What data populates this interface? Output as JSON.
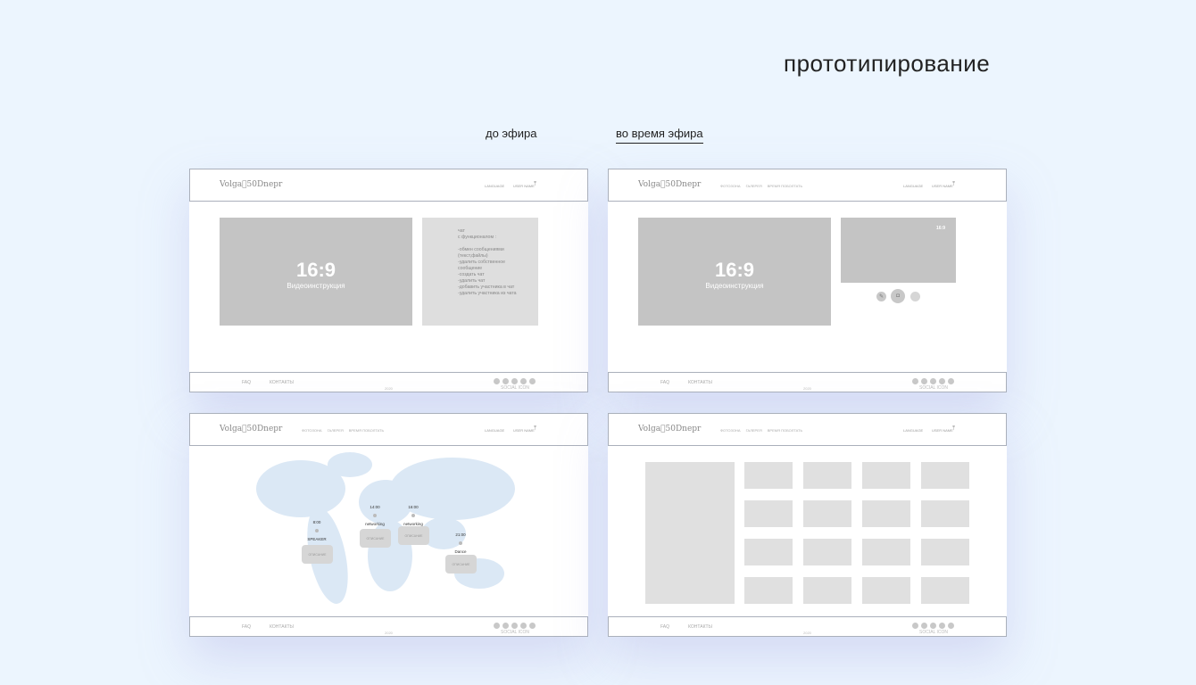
{
  "page_title": "прототипирование",
  "tabs": [
    {
      "label": "до эфира"
    },
    {
      "label": "во время эфира"
    }
  ],
  "header": {
    "logo": "Volga⃝50Dnepr",
    "language": "LANGUAGE",
    "user": "USER NAME",
    "nav": [
      "ФОТОЗОНА",
      "ГАЛЕРЕЯ",
      "ВРЕМЯ ПОБОЛТАТЬ"
    ]
  },
  "footer": {
    "faq": "FAQ",
    "contacts": "КОНТАКТЫ",
    "year": "2020",
    "social": "SOCIAL ICON"
  },
  "video": {
    "ratio": "16:9",
    "caption": "Видеоинструкция"
  },
  "chat": {
    "text": "чат\nс функционалом :\n\n-обмен сообщениями (текст,файлы)\n-удалить собственное сообщение\n-создать чат\n-удалить чат\n-добавить участника в чат\n-удалить участника из чата"
  },
  "small_video": {
    "ratio": "16:9"
  },
  "events": [
    {
      "time": "8:00",
      "name": "SPEAKER",
      "card": "ОПИСАНИЕ"
    },
    {
      "time": "14:00",
      "name": "networking",
      "card": "ОПИСАНИЕ"
    },
    {
      "time": "16:00",
      "name": "networking",
      "card": "ОПИСАНИЕ"
    },
    {
      "time": "21:00",
      "name": "Dance",
      "card": "ОПИСАНИЕ"
    }
  ]
}
